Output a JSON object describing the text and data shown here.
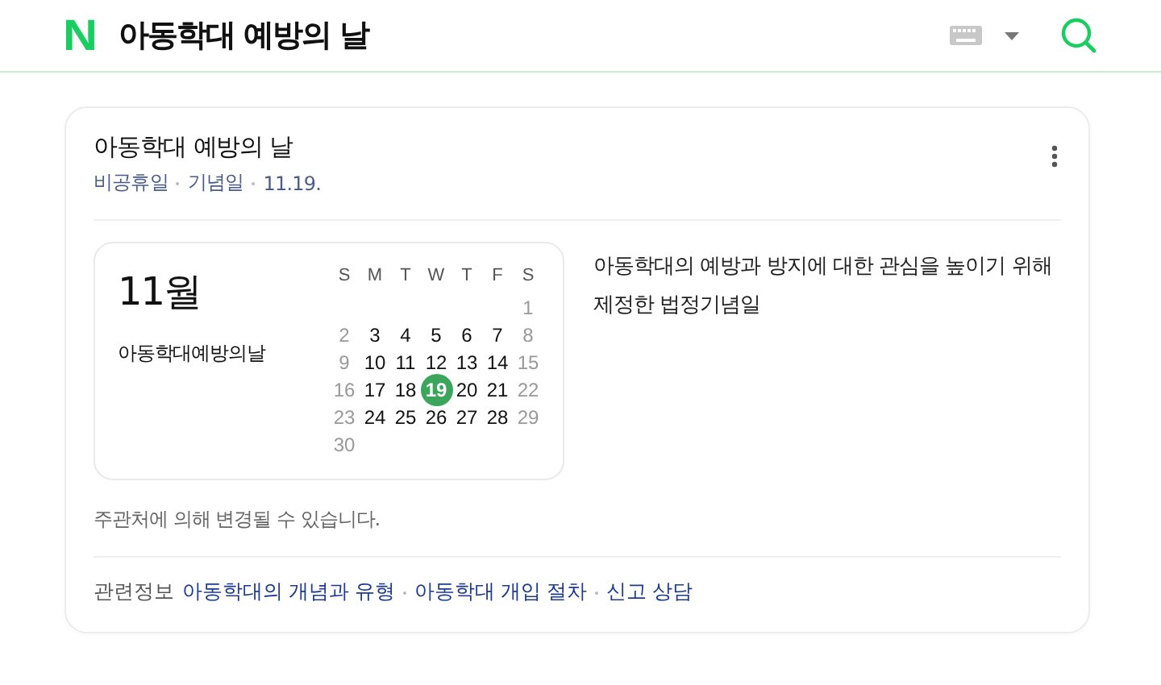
{
  "header": {
    "logo": "N",
    "query": "아동학대 예방의 날"
  },
  "card": {
    "title": "아동학대 예방의 날",
    "tags": [
      "비공휴일",
      "기념일",
      "11.19."
    ],
    "calendar": {
      "month": "11월",
      "event": "아동학대예방의날",
      "weekdays": [
        "S",
        "M",
        "T",
        "W",
        "T",
        "F",
        "S"
      ],
      "weeks": [
        [
          {
            "day": "1",
            "muted": true,
            "selected": false
          }
        ],
        [
          {
            "day": "2",
            "muted": true,
            "selected": false
          },
          {
            "day": "3",
            "muted": false,
            "selected": false
          },
          {
            "day": "4",
            "muted": false,
            "selected": false
          },
          {
            "day": "5",
            "muted": false,
            "selected": false
          },
          {
            "day": "6",
            "muted": false,
            "selected": false
          },
          {
            "day": "7",
            "muted": false,
            "selected": false
          },
          {
            "day": "8",
            "muted": true,
            "selected": false
          }
        ],
        [
          {
            "day": "9",
            "muted": true,
            "selected": false
          },
          {
            "day": "10",
            "muted": false,
            "selected": false
          },
          {
            "day": "11",
            "muted": false,
            "selected": false
          },
          {
            "day": "12",
            "muted": false,
            "selected": false
          },
          {
            "day": "13",
            "muted": false,
            "selected": false
          },
          {
            "day": "14",
            "muted": false,
            "selected": false
          },
          {
            "day": "15",
            "muted": true,
            "selected": false
          }
        ],
        [
          {
            "day": "16",
            "muted": true,
            "selected": false
          },
          {
            "day": "17",
            "muted": false,
            "selected": false
          },
          {
            "day": "18",
            "muted": false,
            "selected": false
          },
          {
            "day": "19",
            "muted": false,
            "selected": true
          },
          {
            "day": "20",
            "muted": false,
            "selected": false
          },
          {
            "day": "21",
            "muted": false,
            "selected": false
          },
          {
            "day": "22",
            "muted": true,
            "selected": false
          }
        ],
        [
          {
            "day": "23",
            "muted": true,
            "selected": false
          },
          {
            "day": "24",
            "muted": false,
            "selected": false
          },
          {
            "day": "25",
            "muted": false,
            "selected": false
          },
          {
            "day": "26",
            "muted": false,
            "selected": false
          },
          {
            "day": "27",
            "muted": false,
            "selected": false
          },
          {
            "day": "28",
            "muted": false,
            "selected": false
          },
          {
            "day": "29",
            "muted": true,
            "selected": false
          }
        ],
        [
          {
            "day": "30",
            "muted": true,
            "selected": false
          }
        ]
      ]
    },
    "description": "아동학대의 예방과 방지에 대한 관심을 높이기 위해 제정한 법정기념일",
    "notice": "주관처에 의해 변경될 수 있습니다.",
    "related": {
      "label": "관련정보",
      "links": [
        "아동학대의 개념과 유형",
        "아동학대 개입 절차",
        "신고 상담"
      ]
    }
  }
}
